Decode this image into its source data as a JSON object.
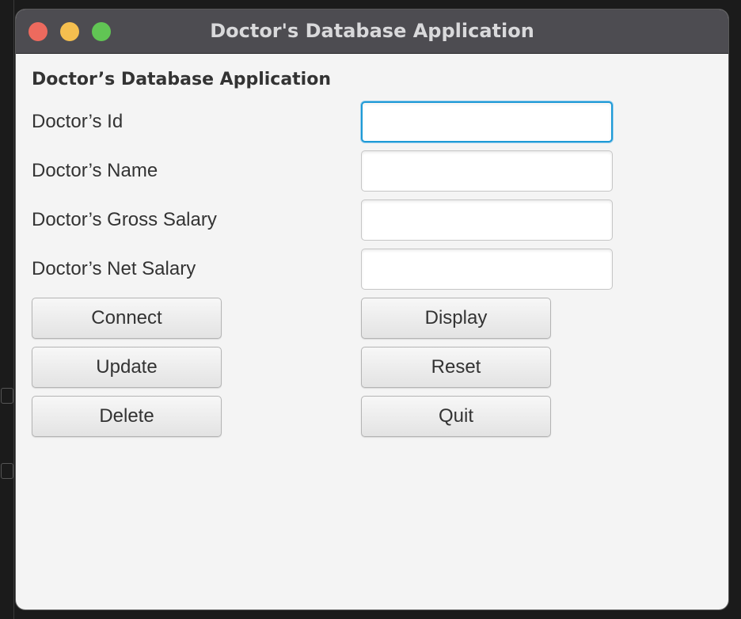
{
  "window": {
    "title": "Doctor's Database Application"
  },
  "form": {
    "heading": "Doctor’s Database Application",
    "fields": [
      {
        "label": "Doctor’s Id",
        "value": ""
      },
      {
        "label": "Doctor’s Name",
        "value": ""
      },
      {
        "label": "Doctor’s Gross Salary",
        "value": ""
      },
      {
        "label": "Doctor’s Net Salary",
        "value": ""
      }
    ]
  },
  "buttons": {
    "connect": "Connect",
    "display": "Display",
    "update": "Update",
    "reset": "Reset",
    "delete": "Delete",
    "quit": "Quit"
  },
  "colors": {
    "titlebar": "#4d4c51",
    "window_bg": "#f4f4f4",
    "focus_ring": "#1e9ad6",
    "close": "#ed6a5e",
    "minimize": "#f5bf4f",
    "maximize": "#61c554"
  }
}
